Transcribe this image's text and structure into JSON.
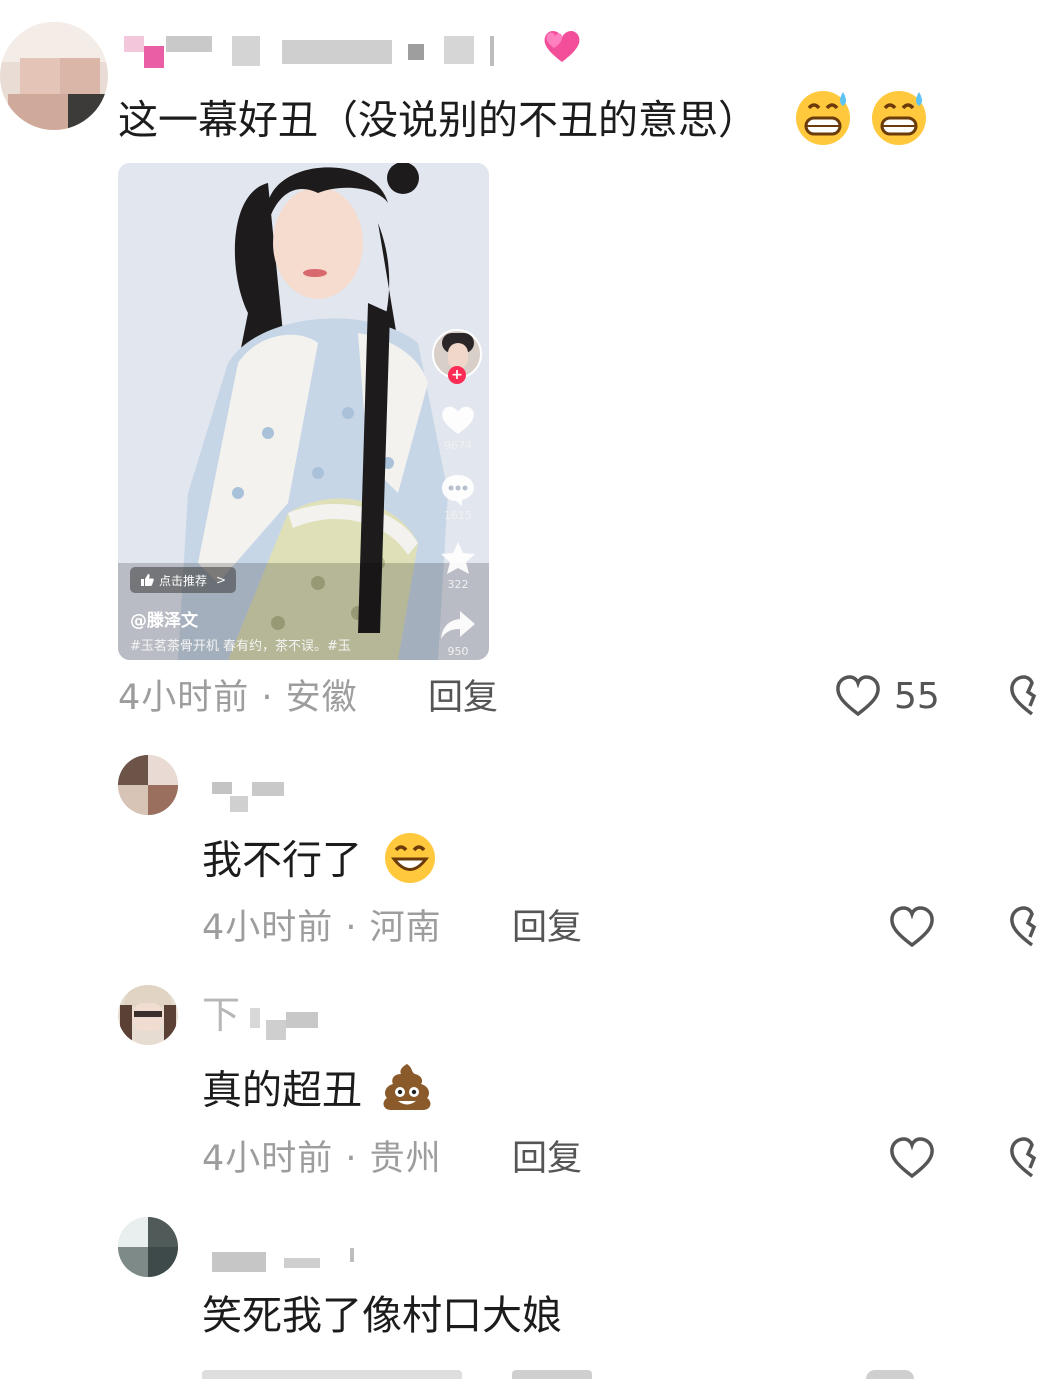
{
  "comments": [
    {
      "text": "这一幕好丑（没说别的不丑的意思）",
      "time": "4小时前",
      "location": "安徽",
      "reply_label": "回复",
      "likes": "55"
    },
    {
      "text": "我不行了",
      "time": "4小时前",
      "location": "河南",
      "reply_label": "回复"
    },
    {
      "name_fragment": "下",
      "text": "真的超丑",
      "time": "4小时前",
      "location": "贵州",
      "reply_label": "回复"
    },
    {
      "text": "笑死我了像村口大娘"
    }
  ],
  "meta_separator": " · ",
  "video": {
    "recommend_label": "点击推荐",
    "recommend_chevron": ">",
    "author": "@滕泽文",
    "caption": "#玉茗茶骨开机 春有约，茶不误。#玉",
    "likes": "9674",
    "comments": "1615",
    "favorites": "322",
    "shares": "950"
  },
  "icons": {
    "heart": "heart-outline-icon",
    "dislike": "broken-heart-icon",
    "emoji_sweat_grin": "grinning-sweat-emoji",
    "emoji_grin": "grinning-emoji",
    "emoji_poop": "poop-emoji",
    "emoji_hearts": "sparkling-hearts-emoji"
  },
  "colors": {
    "text": "#1c1c1c",
    "meta": "#9d9d9d",
    "reply": "#555555",
    "follow_badge": "#fe2c55"
  }
}
